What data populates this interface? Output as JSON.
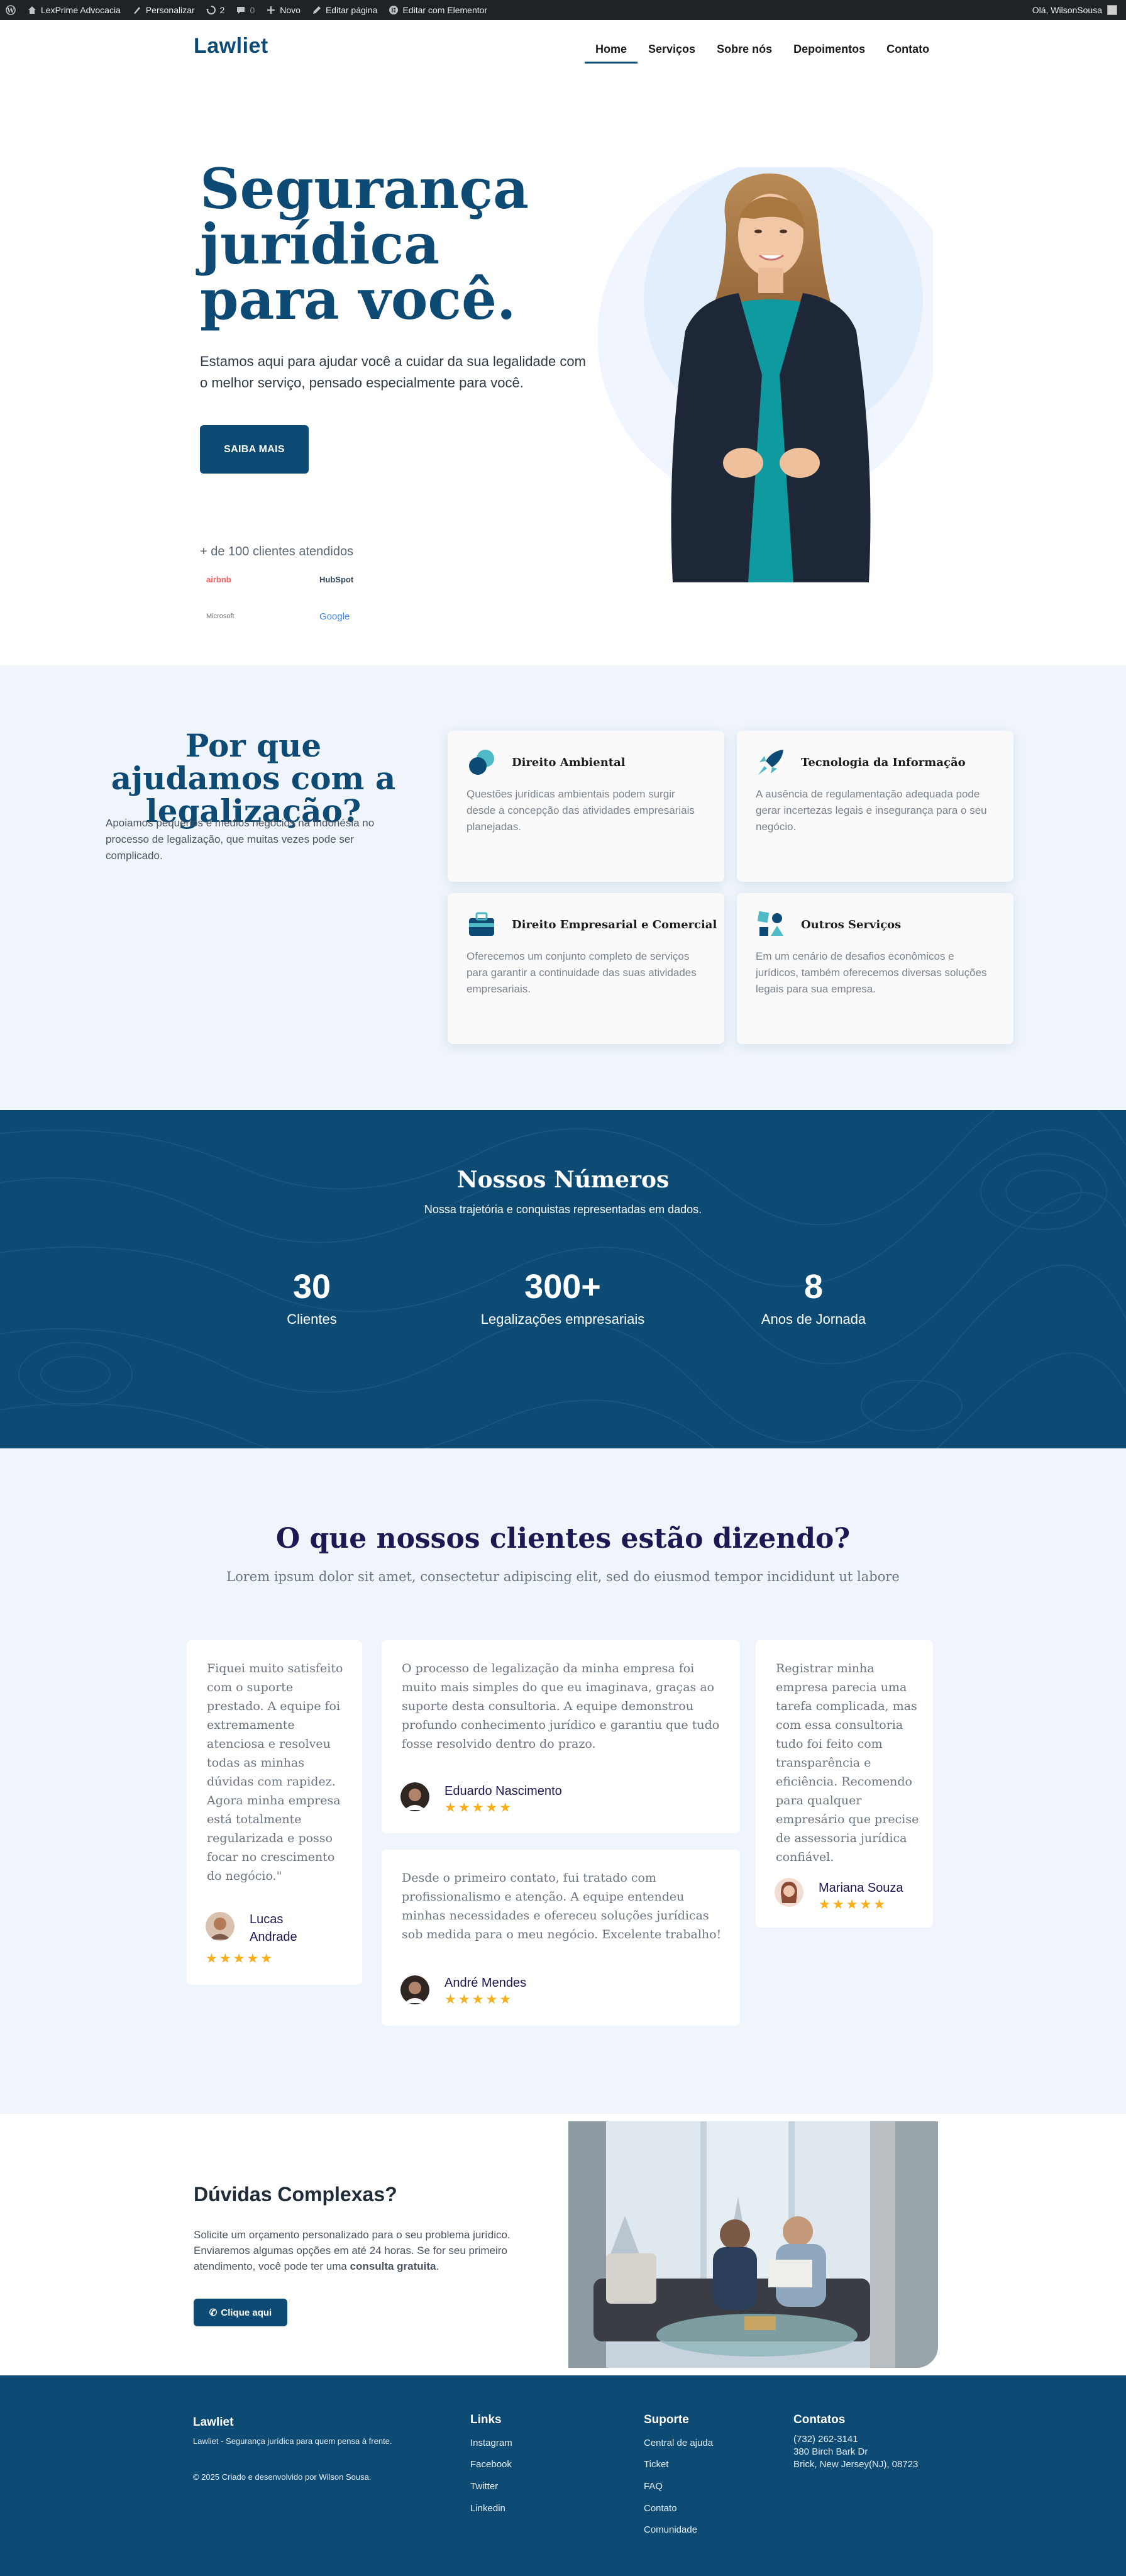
{
  "adminbar": {
    "site_name": "LexPrime Advocacia",
    "customize": "Personalizar",
    "updates_count": "2",
    "comments_count": "0",
    "new": "Novo",
    "edit_page": "Editar página",
    "edit_elementor": "Editar com Elementor",
    "greeting": "Olá, WilsonSousa"
  },
  "header": {
    "logo": "Lawliet",
    "nav": [
      "Home",
      "Serviços",
      "Sobre nós",
      "Depoimentos",
      "Contato"
    ],
    "active": "Home"
  },
  "hero": {
    "title": "Segurança jurídica para você.",
    "subtitle": "Estamos aqui para ajudar você a cuidar da sua legalidade com o melhor serviço, pensado especialmente para você.",
    "button": "SAIBA MAIS",
    "clients_label": "+ de 100 clientes atendidos",
    "client_logos": [
      "airbnb",
      "HubSpot",
      "Microsoft",
      "Google"
    ]
  },
  "why": {
    "title": "Por que ajudamos com a legalização?",
    "description": "Apoiamos pequenos e médios negócios na Indonésia no processo de legalização, que muitas vezes pode ser complicado.",
    "services": [
      {
        "title": "Direito Ambiental",
        "icon": "leaf-circles-icon",
        "description": "Questões jurídicas ambientais podem surgir desde a concepção das atividades empresariais planejadas."
      },
      {
        "title": "Tecnologia da Informação",
        "icon": "rocket-icon",
        "description": "A ausência de regulamentação adequada pode gerar incertezas legais e insegurança para o seu negócio."
      },
      {
        "title": "Direito Empresarial e Comercial",
        "icon": "briefcase-icon",
        "description": "Oferecemos um conjunto completo de serviços para garantir a continuidade das suas atividades empresariais."
      },
      {
        "title": "Outros Serviços",
        "icon": "shapes-icon",
        "description": "Em um cenário de desafios econômicos e jurídicos, também oferecemos diversas soluções legais para sua empresa."
      }
    ]
  },
  "numbers": {
    "title": "Nossos Números",
    "subtitle": "Nossa trajetória e conquistas representadas em dados.",
    "stats": [
      {
        "value": "30",
        "label": "Clientes"
      },
      {
        "value": "300+",
        "label": "Legalizações empresariais"
      },
      {
        "value": "8",
        "label": "Anos de Jornada"
      }
    ]
  },
  "testimonials": {
    "title": "O que nossos clientes estão dizendo?",
    "subtitle": "Lorem ipsum dolor sit amet, consectetur adipiscing elit, sed do eiusmod tempor incididunt ut labore",
    "items": [
      {
        "quote": "Fiquei muito satisfeito com o suporte prestado. A equipe foi extremamente atenciosa e resolveu todas as minhas dúvidas com rapidez. Agora minha empresa está totalmente regularizada e posso focar no crescimento do negócio.\"",
        "name": "Lucas Andrade",
        "stars": "★★★★★",
        "rating": 5
      },
      {
        "quote": "O processo de legalização da minha empresa foi muito mais simples do que eu imaginava, graças ao suporte desta consultoria. A equipe demonstrou profundo conhecimento jurídico e garantiu que tudo fosse resolvido dentro do prazo.",
        "name": "Eduardo Nascimento",
        "stars": "★★★★★",
        "rating": 5
      },
      {
        "quote": "Desde o primeiro contato, fui tratado com profissionalismo e atenção. A equipe entendeu minhas necessidades e ofereceu soluções jurídicas sob medida para o meu negócio. Excelente trabalho!",
        "name": "André Mendes",
        "stars": "★★★★★",
        "rating": 5
      },
      {
        "quote": "Registrar minha empresa parecia uma tarefa complicada, mas com essa consultoria tudo foi feito com transparência e eficiência. Recomendo para qualquer empresário que precise de assessoria jurídica confiável.",
        "name": "Mariana Souza",
        "stars": "★★★★★",
        "rating": 5
      }
    ]
  },
  "cta": {
    "title": "Dúvidas Complexas?",
    "text_before": "Solicite um orçamento personalizado para o seu problema jurídico. Enviaremos algumas opções em até 24 horas. Se for seu primeiro atendimento, você pode ter uma ",
    "text_bold": "consulta gratuita",
    "text_after": ".",
    "button": "Clique aqui"
  },
  "footer": {
    "brand": "Lawliet",
    "tagline": "Lawliet - Segurança jurídica para quem pensa à frente.",
    "copyright": "© 2025 Criado e desenvolvido por Wilson Sousa.",
    "links_title": "Links",
    "links": [
      "Instagram",
      "Facebook",
      "Twitter",
      "Linkedin"
    ],
    "support_title": "Suporte",
    "support": [
      "Central de ajuda",
      "Ticket",
      "FAQ",
      "Contato",
      "Comunidade"
    ],
    "contacts_title": "Contatos",
    "contacts": [
      "(732) 262-3141",
      "380 Birch Bark Dr",
      "Brick, New Jersey(NJ), 08723"
    ]
  },
  "colors": {
    "primary": "#0d4a74",
    "light_bg": "#f0f5fc",
    "star": "#f6b01e",
    "heading_dark": "#1c1852"
  }
}
